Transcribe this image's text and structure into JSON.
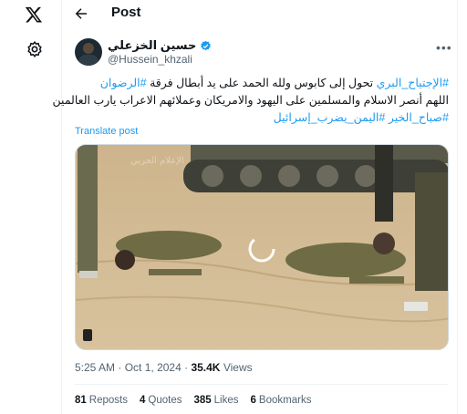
{
  "header": {
    "title": "Post"
  },
  "tweet": {
    "author_name": "حسين الخزعلي",
    "handle": "@Hussein_khzali",
    "text_lines": [
      [
        {
          "t": "#الإجتياح_البري",
          "h": true
        },
        {
          "t": " تحول إلى كابوس ولله الحمد على يد أبطال فرقة ",
          "h": false
        },
        {
          "t": "#الرضوان",
          "h": true
        }
      ],
      [
        {
          "t": "اللهم أنصر الاسلام والمسلمين على اليهود والامريكان وعملائهم الاعراب يارب العالمين",
          "h": false
        }
      ],
      [
        {
          "t": "#صباح_الخير",
          "h": true
        },
        {
          "t": " ",
          "h": false
        },
        {
          "t": "#اليمن_يضرب_إسرائيل",
          "h": true
        }
      ]
    ],
    "translate_label": "Translate post",
    "media_watermark": "الإعلام الحربي",
    "time": "5:25 AM",
    "date": "Oct 1, 2024",
    "views_count": "35.4K",
    "views_label": "Views"
  },
  "stats": {
    "reposts_count": "81",
    "reposts_label": "Reposts",
    "quotes_count": "4",
    "quotes_label": "Quotes",
    "likes_count": "385",
    "likes_label": "Likes",
    "bookmarks_count": "6",
    "bookmarks_label": "Bookmarks"
  },
  "colors": {
    "accent": "#1d9bf0",
    "text": "#0f1419",
    "muted": "#536471",
    "border": "#eff3f4"
  },
  "icons": [
    "x-logo-icon",
    "settings-gear-icon",
    "back-arrow-icon",
    "verified-badge-icon",
    "more-options-icon"
  ]
}
